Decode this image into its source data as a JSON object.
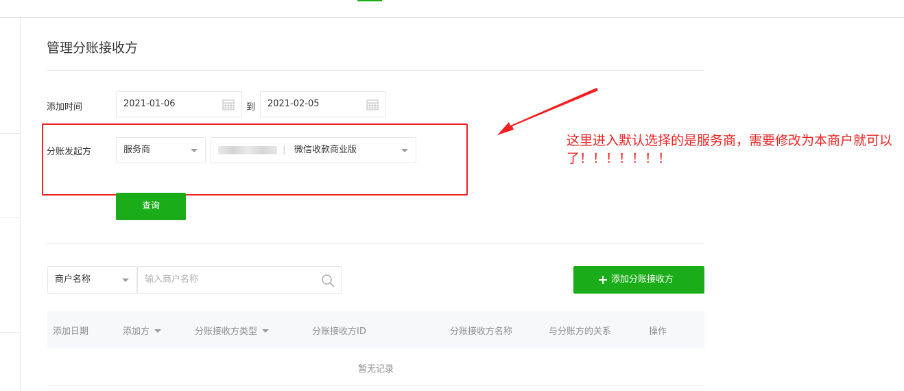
{
  "page": {
    "title": "管理分账接收方"
  },
  "filters": {
    "time_label": "添加时间",
    "start_date": "2021-01-06",
    "to_label": "到",
    "end_date": "2021-02-05",
    "initiator_label": "分账发起方",
    "initiator_value": "服务商",
    "merchant_product": "微信收款商业版",
    "query_button": "查询"
  },
  "annotation": {
    "text": "这里进入默认选择的是服务商，需要修改为本商户就可以了！！！！！！！"
  },
  "search": {
    "field_select": "商户名称",
    "placeholder": "输入商户名称",
    "add_button": "添加分账接收方",
    "add_icon": "plus-icon"
  },
  "table": {
    "columns": [
      "添加日期",
      "添加方",
      "分账接收方类型",
      "分账接收方ID",
      "分账接收方名称",
      "与分账方的关系",
      "操作"
    ],
    "empty_text": "暂无记录"
  },
  "colors": {
    "accent": "#1aad19",
    "annotation": "#f21f1f"
  }
}
